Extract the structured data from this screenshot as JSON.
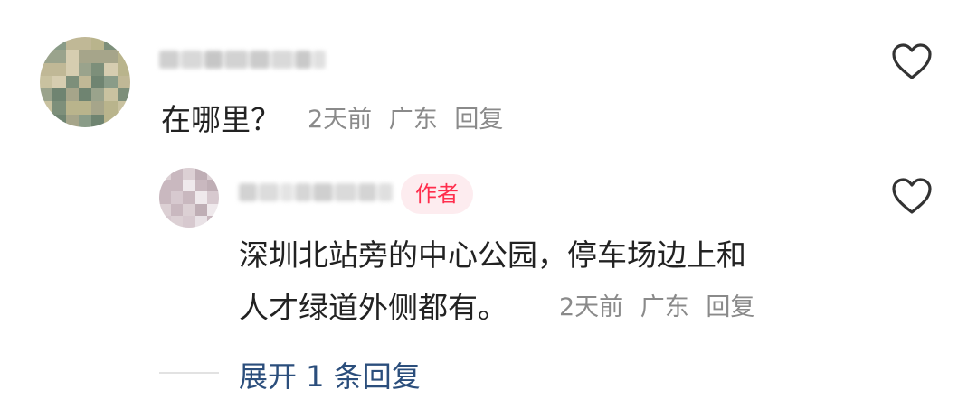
{
  "comment": {
    "text": "在哪里？",
    "time": "2天前",
    "location": "广东",
    "reply_label": "回复"
  },
  "reply": {
    "badge": "作者",
    "text_line1": "深圳北站旁的中心公园，停车场边上和",
    "text_line2": "人才绿道外侧都有。",
    "time": "2天前",
    "location": "广东",
    "reply_label": "回复"
  },
  "expand_label": "展开 1 条回复",
  "colors": {
    "badge_text": "#ff2e4d",
    "badge_bg": "#fdecef",
    "expand_link": "#2b4e7c",
    "meta_text": "#8a8a8a"
  },
  "icons": [
    "heart-icon",
    "heart-icon"
  ]
}
